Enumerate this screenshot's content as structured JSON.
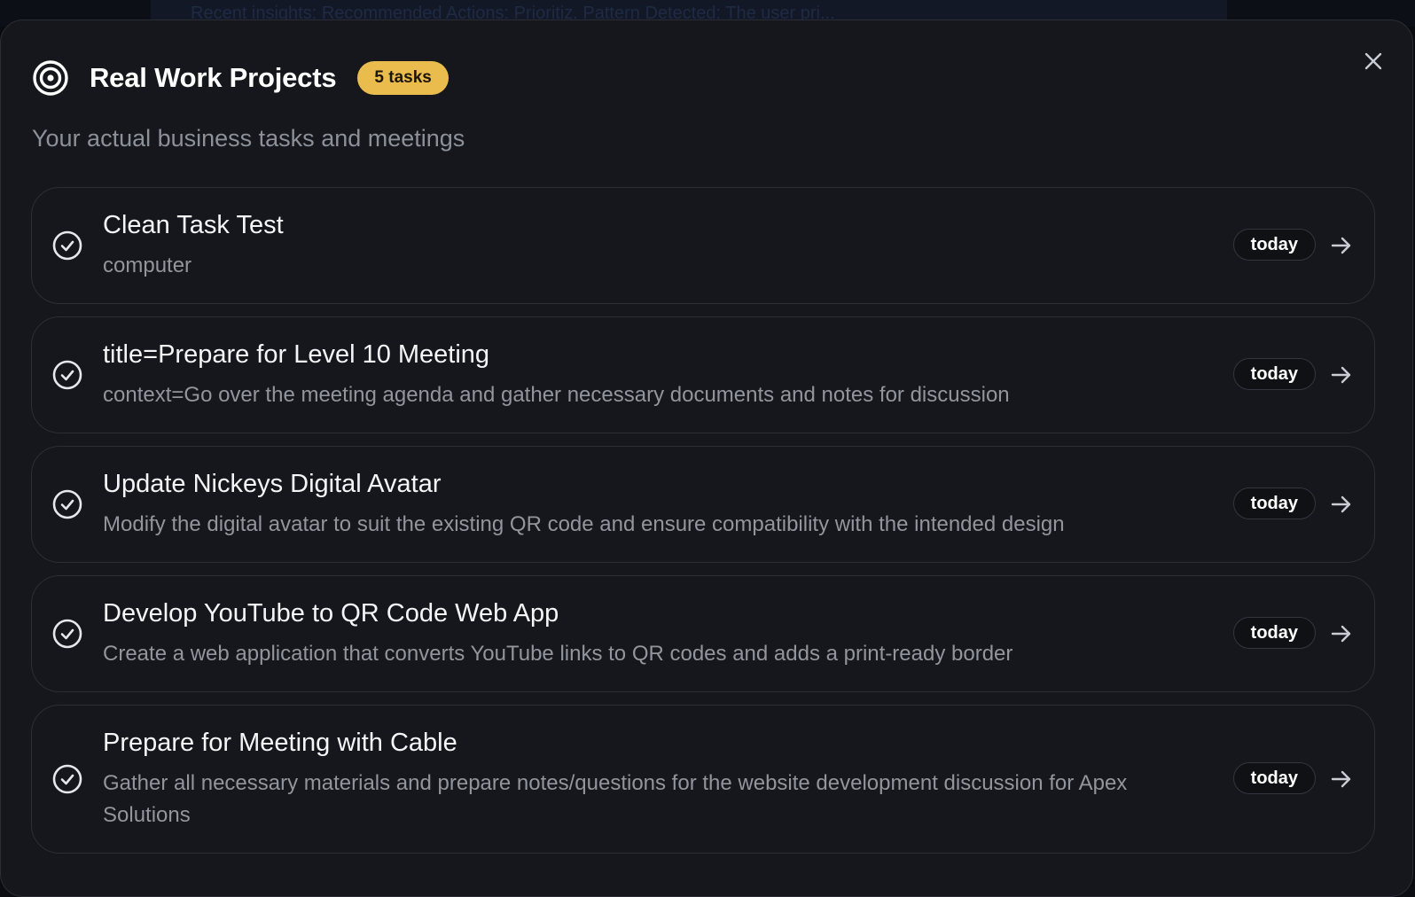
{
  "background": {
    "banner_text": "Recent insights: Recommended Actions: Prioritiz. Pattern Detected: The user pri..."
  },
  "modal": {
    "title": "Real Work Projects",
    "badge": "5 tasks",
    "subtitle": "Your actual business tasks and meetings",
    "icons": {
      "header": "target-icon",
      "close": "close-icon",
      "task_status": "check-circle-icon",
      "open": "arrow-right-icon"
    },
    "colors": {
      "badge": "#e9bc4d",
      "background": "#15171c"
    }
  },
  "tasks": [
    {
      "title": "Clean Task Test",
      "description": "computer",
      "due": "today"
    },
    {
      "title": "title=Prepare for Level 10 Meeting",
      "description": "context=Go over the meeting agenda and gather necessary documents and notes for discussion",
      "due": "today"
    },
    {
      "title": "Update Nickeys Digital Avatar",
      "description": "Modify the digital avatar to suit the existing QR code and ensure compatibility with the intended design",
      "due": "today"
    },
    {
      "title": "Develop YouTube to QR Code Web App",
      "description": "Create a web application that converts YouTube links to QR codes and adds a print-ready border",
      "due": "today"
    },
    {
      "title": "Prepare for Meeting with Cable",
      "description": "Gather all necessary materials and prepare notes/questions for the website development discussion for Apex Solutions",
      "due": "today"
    }
  ]
}
